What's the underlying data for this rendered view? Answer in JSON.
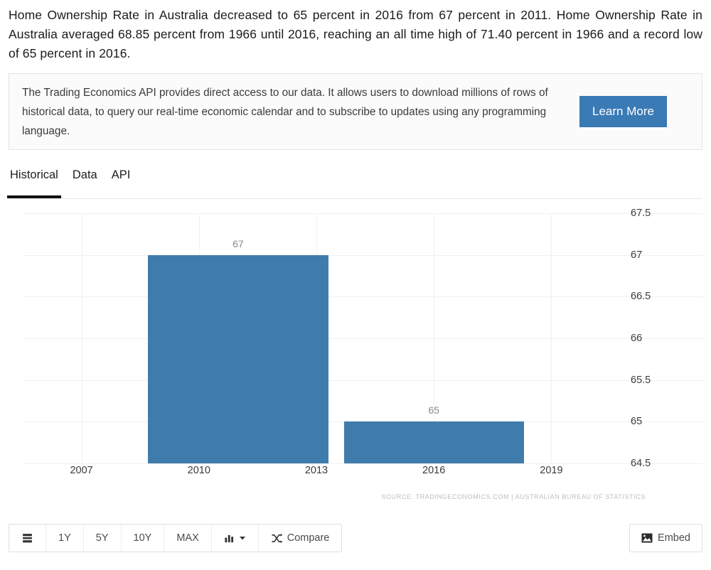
{
  "intro": {
    "text": "Home Ownership Rate in Australia decreased to 65 percent in 2016 from 67 percent in 2011. Home Ownership Rate in Australia averaged 68.85 percent from 1966 until 2016, reaching an all time high of 71.40 percent in 1966 and a record low of 65 percent in 2016."
  },
  "api_promo": {
    "text": "The Trading Economics API provides direct access to our data. It allows users to download millions of rows of historical data, to query our real-time economic calendar and to subscribe to updates using any programming language.",
    "button_label": "Learn More",
    "button_color": "#3a7ab5"
  },
  "tabs": [
    {
      "label": "Historical",
      "active": true
    },
    {
      "label": "Data",
      "active": false
    },
    {
      "label": "API",
      "active": false
    }
  ],
  "chart_data": {
    "type": "bar",
    "title": "",
    "subtitle": "",
    "xlabel": "",
    "ylabel": "",
    "categories": [
      "2011",
      "2016"
    ],
    "values": [
      67,
      65
    ],
    "data_labels": [
      "67",
      "65"
    ],
    "ylim": [
      64.5,
      67.5
    ],
    "y_ticks": [
      "67.5",
      "67",
      "66.5",
      "66",
      "65.5",
      "65",
      "64.5"
    ],
    "y_tick_values": [
      67.5,
      67,
      66.5,
      66,
      65.5,
      65,
      64.5
    ],
    "x_ticks": [
      "2007",
      "2010",
      "2013",
      "2016",
      "2019"
    ],
    "x_tick_values": [
      2007,
      2010,
      2013,
      2016,
      2019
    ],
    "xlim": [
      2005.5,
      2020.5
    ],
    "grid": true,
    "legend": "none",
    "bar_color": "#407cab",
    "source": "SOURCE: TRADINGECONOMICS.COM | AUSTRALIAN BUREAU OF STATISTICS"
  },
  "toolbar": {
    "list_icon": "list-icon",
    "ranges": [
      "1Y",
      "5Y",
      "10Y",
      "MAX"
    ],
    "chart_type_icon": "bar-chart-icon",
    "chart_type_caret": "chevron-down-icon",
    "compare_icon": "shuffle-icon",
    "compare_label": "Compare",
    "embed_icon": "image-icon",
    "embed_label": "Embed"
  }
}
